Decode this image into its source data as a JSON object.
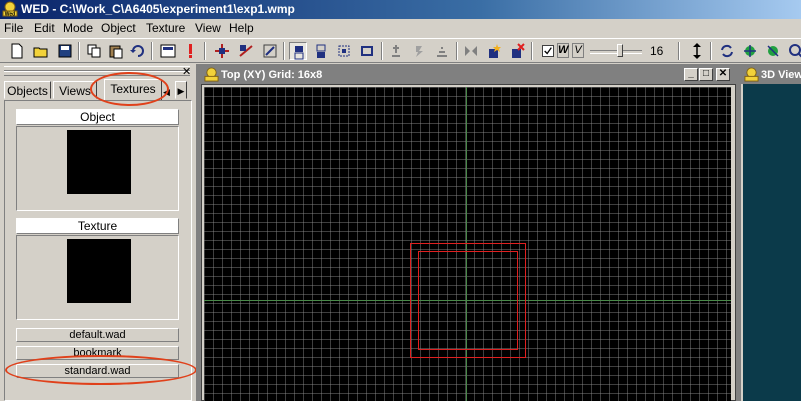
{
  "window": {
    "title": "WED - C:\\Work_C\\A6405\\experiment1\\exp1.wmp"
  },
  "menu": {
    "items": [
      "File",
      "Edit",
      "Mode",
      "Object",
      "Texture",
      "View",
      "Help"
    ]
  },
  "toolbar": {
    "checks": [
      "W",
      "V"
    ],
    "slider_value": "16"
  },
  "left_panel": {
    "tabs": [
      "Objects",
      "Views",
      "Textures"
    ],
    "active_tab": "Textures",
    "object_label": "Object",
    "texture_label": "Texture",
    "wad_items": [
      "default.wad",
      "bookmark",
      "standard.wad"
    ]
  },
  "top_view": {
    "title": "Top (XY) Grid: 16x8"
  },
  "side_view": {
    "title": "3D View"
  },
  "colors": {
    "title_gradient_start": "#0a246a",
    "title_gradient_end": "#a6caf0",
    "annotation": "#e0401a",
    "selection_box": "#e02020",
    "grid_axis": "#4a8a4a",
    "view_3d_bg": "#0b3a4a"
  }
}
